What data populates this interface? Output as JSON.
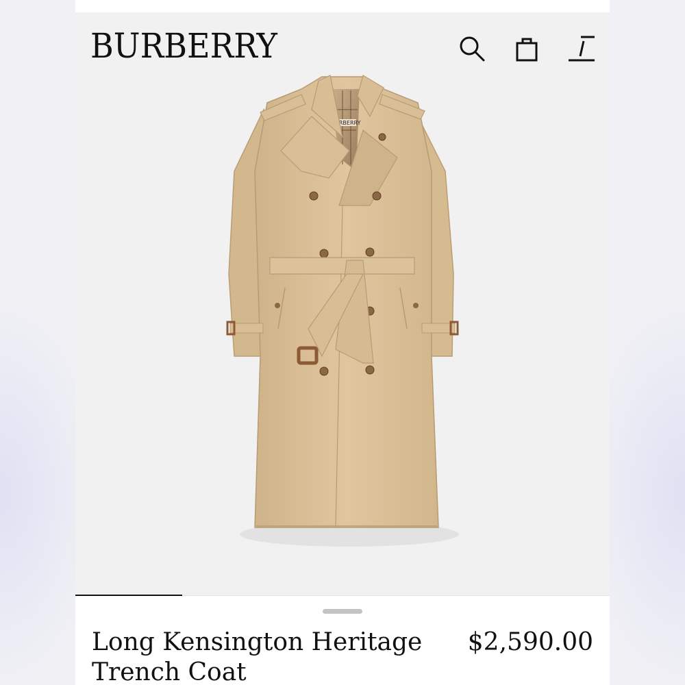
{
  "header": {
    "brand": "BURBERRY",
    "icons": [
      "search-icon",
      "shopping-bag-icon",
      "menu-icon"
    ]
  },
  "product": {
    "image": "beige-trench-coat",
    "title_line1": "Long Kensington Heritage",
    "title_line2": "Trench Coat",
    "price": "$2,590.00",
    "label_text": "BURBERRY"
  },
  "carousel": {
    "current_index": 1
  },
  "colors": {
    "coat": "#dcc299",
    "coat_shadow": "#c9ac80",
    "background": "#f1f1f1",
    "text": "#111111"
  }
}
